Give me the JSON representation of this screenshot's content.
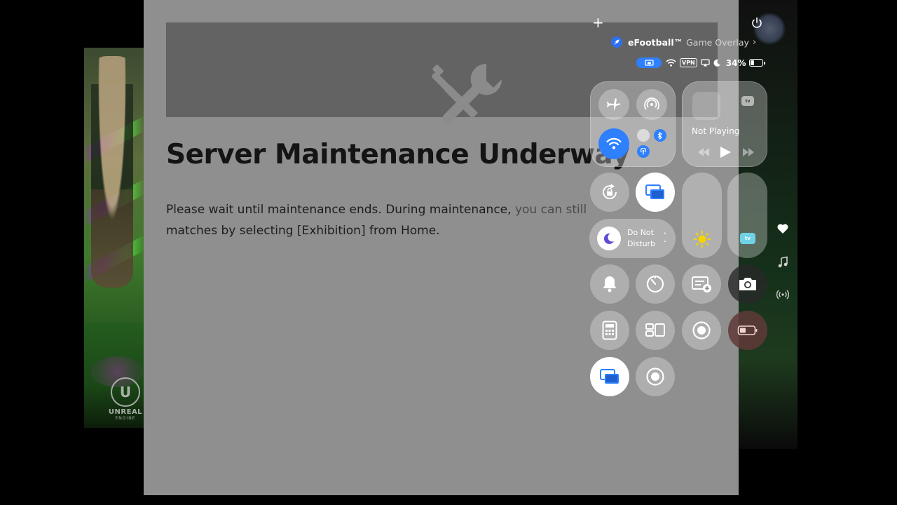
{
  "maintenance": {
    "title": "Server Maintenance Underway",
    "message_main": "Please wait until maintenance ends. During maintenance, ",
    "message_obscured": "you can still",
    "message_line2": "matches by selecting [Exhibition] from Home."
  },
  "game_logo": {
    "engine_name": "UNREAL",
    "engine_sub": "ENGINE",
    "mark": "U"
  },
  "control_center": {
    "overlay": {
      "app_name": "eFootball™",
      "label": "Game Overlay",
      "chevron": "›"
    },
    "status_bar": {
      "vpn": "VPN",
      "battery_percent": "34%",
      "battery_level": 0.34
    },
    "media": {
      "status": "Not Playing",
      "appletv_badge": "tv"
    },
    "dnd": {
      "label": "Do Not Disturb",
      "chevron_up": "⌃",
      "chevron_down": "⌄"
    },
    "brightness_level": 0.0,
    "appletv_level": 0.0
  },
  "colors": {
    "accent_blue": "#2e80ff",
    "panel_gray": "#8f8f8f",
    "banner_gray": "#636363",
    "title_dark": "#141414"
  }
}
